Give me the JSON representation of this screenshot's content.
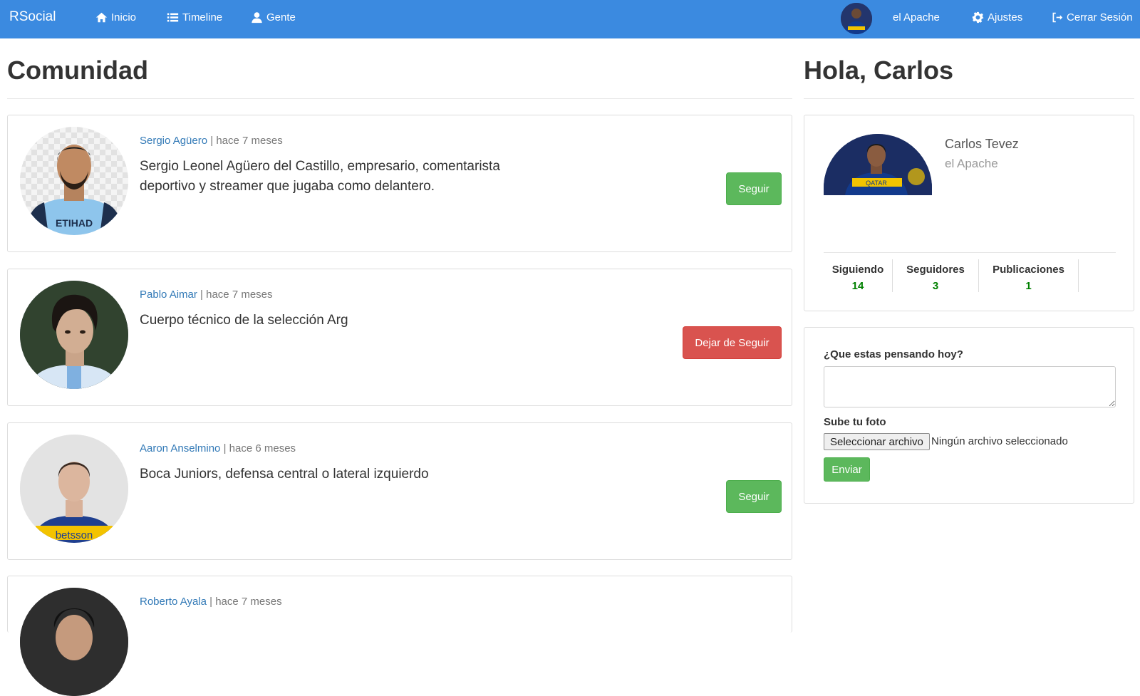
{
  "navbar": {
    "brand": "RSocial",
    "links": [
      {
        "label": "Inicio",
        "icon": "home-icon"
      },
      {
        "label": "Timeline",
        "icon": "list-icon"
      },
      {
        "label": "Gente",
        "icon": "user-icon"
      }
    ],
    "user_nick": "el Apache",
    "settings_label": "Ajustes",
    "logout_label": "Cerrar Sesión",
    "colors": {
      "bar": "#3b8ae0"
    }
  },
  "main": {
    "title": "Comunidad",
    "users": [
      {
        "name": "Sergio Agüero",
        "time": "hace 7 meses",
        "bio": "Sergio Leonel Agüero del Castillo, empresario, comentarista deportivo y streamer que jugaba como delantero.",
        "action": "Seguir",
        "action_type": "follow"
      },
      {
        "name": "Pablo Aimar",
        "time": "hace 7 meses",
        "bio": "Cuerpo técnico de la selección Arg",
        "action": "Dejar de Seguir",
        "action_type": "unfollow"
      },
      {
        "name": "Aaron Anselmino",
        "time": "hace 6 meses",
        "bio": "Boca Juniors, defensa central o lateral izquierdo",
        "action": "Seguir",
        "action_type": "follow"
      },
      {
        "name": "Roberto Ayala",
        "time": "hace 7 meses"
      }
    ],
    "separator": "|"
  },
  "sidebar": {
    "greeting": "Hola, Carlos",
    "profile": {
      "name": "Carlos Tevez",
      "nick": "el Apache"
    },
    "stats": [
      {
        "label": "Siguiendo",
        "value": "14"
      },
      {
        "label": "Seguidores",
        "value": "3"
      },
      {
        "label": "Publicaciones",
        "value": "1"
      }
    ],
    "form": {
      "question_label": "¿Que estas pensando hoy?",
      "textarea_value": "",
      "photo_label": "Sube tu foto",
      "file_button": "Seleccionar archivo",
      "file_status": "Ningún archivo seleccionado",
      "submit_label": "Enviar"
    }
  }
}
